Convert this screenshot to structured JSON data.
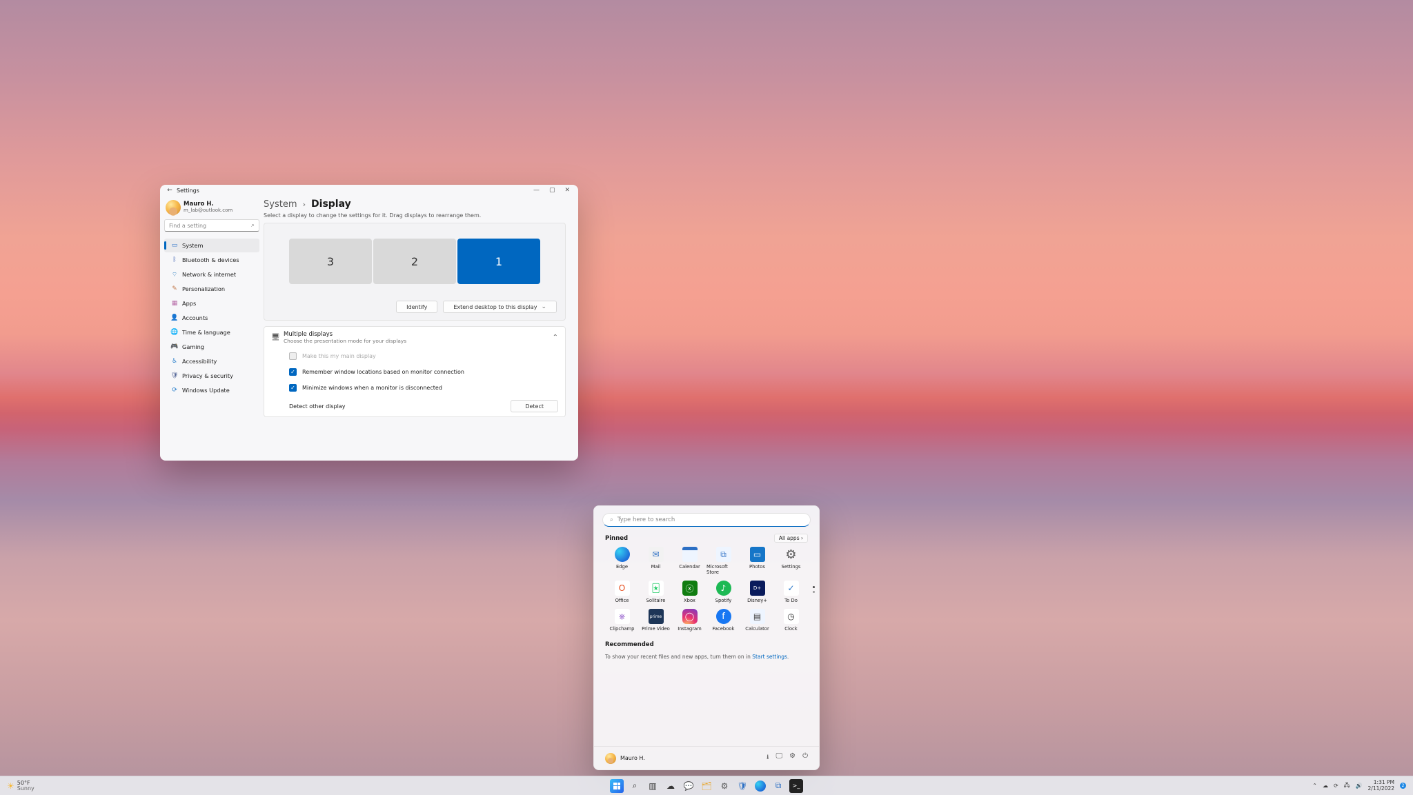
{
  "settings": {
    "title": "Settings",
    "user": {
      "name": "Mauro H.",
      "email": "m_lab@outlook.com"
    },
    "search_placeholder": "Find a setting",
    "nav": {
      "items": [
        {
          "label": "System"
        },
        {
          "label": "Bluetooth & devices"
        },
        {
          "label": "Network & internet"
        },
        {
          "label": "Personalization"
        },
        {
          "label": "Apps"
        },
        {
          "label": "Accounts"
        },
        {
          "label": "Time & language"
        },
        {
          "label": "Gaming"
        },
        {
          "label": "Accessibility"
        },
        {
          "label": "Privacy & security"
        },
        {
          "label": "Windows Update"
        }
      ]
    },
    "breadcrumb": {
      "root": "System",
      "leaf": "Display"
    },
    "desc": "Select a display to change the settings for it. Drag displays to rearrange them.",
    "monitors": {
      "m3": "3",
      "m2": "2",
      "m1": "1"
    },
    "identify_btn": "Identify",
    "extend_btn": "Extend desktop to this display",
    "multi": {
      "title": "Multiple displays",
      "desc": "Choose the presentation mode for your displays",
      "make_main": "Make this my main display",
      "remember": "Remember window locations based on monitor connection",
      "minimize": "Minimize windows when a monitor is disconnected",
      "detect_label": "Detect other display",
      "detect_btn": "Detect"
    }
  },
  "start": {
    "search_placeholder": "Type here to search",
    "pinned_label": "Pinned",
    "all_apps_label": "All apps",
    "apps": [
      {
        "label": "Edge"
      },
      {
        "label": "Mail"
      },
      {
        "label": "Calendar"
      },
      {
        "label": "Microsoft Store"
      },
      {
        "label": "Photos"
      },
      {
        "label": "Settings"
      },
      {
        "label": "Office"
      },
      {
        "label": "Solitaire"
      },
      {
        "label": "Xbox"
      },
      {
        "label": "Spotify"
      },
      {
        "label": "Disney+"
      },
      {
        "label": "To Do"
      },
      {
        "label": "Clipchamp"
      },
      {
        "label": "Prime Video"
      },
      {
        "label": "Instagram"
      },
      {
        "label": "Facebook"
      },
      {
        "label": "Calculator"
      },
      {
        "label": "Clock"
      }
    ],
    "reco_label": "Recommended",
    "reco_text_a": "To show your recent files and new apps, turn them on in ",
    "reco_link": "Start settings",
    "reco_text_b": ".",
    "footer_name": "Mauro H."
  },
  "taskbar": {
    "weather_temp": "50°F",
    "weather_desc": "Sunny",
    "time": "1:31 PM",
    "date": "2/11/2022",
    "notif_count": "2"
  }
}
